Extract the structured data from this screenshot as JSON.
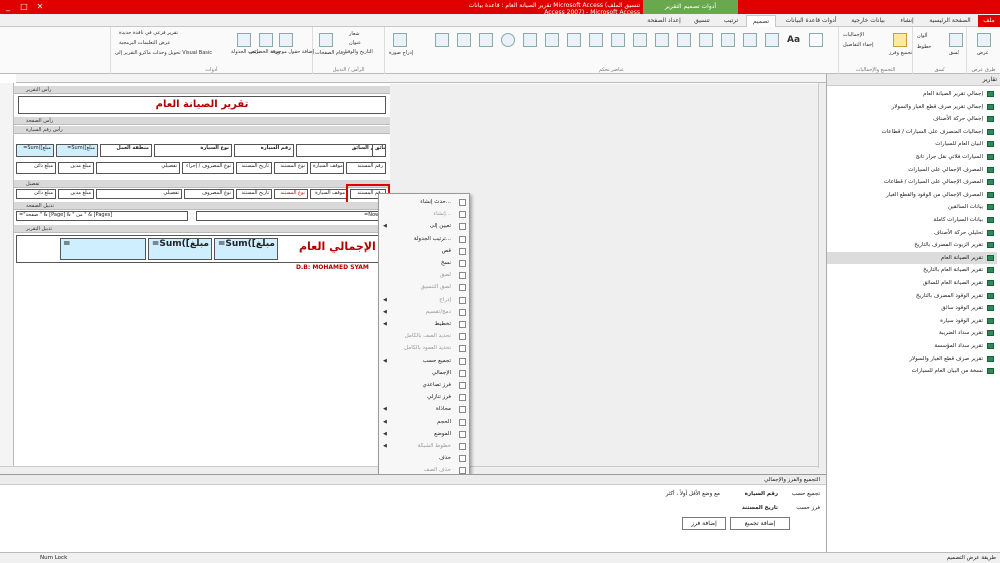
{
  "window": {
    "title": "تقرير الصيانة العام : قاعدة بيانات Microsoft Access (تنسيق الملف Access 2007) - Microsoft Access",
    "tools_tab": "أدوات تصميم التقرير",
    "buttons": [
      "_",
      "□",
      "✕"
    ]
  },
  "tabs": {
    "file": "ملف",
    "home": "الصفحة الرئيسية",
    "create": "إنشاء",
    "external": "بيانات خارجية",
    "dbtools": "أدوات قاعدة البيانات",
    "design": "تصميم",
    "arrange": "ترتيب",
    "format": "تنسيق",
    "pagesetup": "إعداد الصفحة"
  },
  "ribbon": {
    "views": {
      "label": "طرق عرض",
      "view_btn": "عرض"
    },
    "themes": {
      "label": "نُسق",
      "themes_btn": "نُسق",
      "colors": "ألوان",
      "fonts": "خطوط"
    },
    "grouping": {
      "label": "التجميع والإجماليات",
      "group_sort": "تجميع وفرز",
      "totals": "الإجماليات",
      "hide_details": "إخفاء التفاصيل"
    },
    "controls": {
      "label": "عناصر تحكم",
      "insert_image": "إدراج صورة"
    },
    "header_footer": {
      "label": "الرأس / التذييل",
      "logo": "شعار",
      "title": "عنوان",
      "date_time": "التاريخ والوقت",
      "page_numbers": "أرقام الصفحات"
    },
    "tools": {
      "label": "أدوات",
      "add_fields": "إضافة حقول موجودة",
      "property_sheet": "ورقة الخصائص",
      "tab_order": "ترتيب الجدولة",
      "subreport": "تقرير فرعي في نافذة جديدة",
      "view_code": "عرض التعليمات البرمجية",
      "convert_macros": "تحويل وحدات ماكرو التقرير إلى Visual Basic"
    }
  },
  "nav": {
    "header": "تقارير",
    "items": [
      "إجمالي تقرير الصيانة العام",
      "إجمالي تقرير صرف قطع الغيار والسولار",
      "إجمالي حركة الأصناف",
      "إجماليات المنصرف على السيارات / قطاعات",
      "البيان العام للسيارات",
      "السيارات فلاتي نقل جرار تانج",
      "المصرف الإجمالي على السيارات",
      "المصرف الإجمالي على السيارات / قطاعات",
      "المصرف الإجمالي من الوقود والقطع الغيار",
      "بيانات السائقين",
      "بيانات السيارات كاملة",
      "تحليلي حركة الأصناف",
      "تقرير الزيوت المصرف بالتاريخ",
      "تقرير الصيانة العام",
      "تقرير الصيانة العام بالتاريخ",
      "تقرير الصيانة العام للسائق",
      "تقرير الوقود المصرف بالتاريخ",
      "تقرير الوقود سائق",
      "تقرير الوقود سيارة",
      "تقرير سداد الضريبة",
      "تقرير سداد المؤسسة",
      "تقرير صرف قطع الغيار والسولار",
      "نسخة من  البيان العام للسيارات"
    ],
    "selected_index": 13
  },
  "report": {
    "sections": {
      "report_header": "رأس التقرير",
      "page_header": "رأس الصفحة",
      "car_header": "رأس رقم السيارة",
      "detail": "تفصيل",
      "page_footer": "تذييل الصفحة",
      "report_footer": "تذييل التقرير"
    },
    "title": "تقرير الصيانة العام",
    "group_row": {
      "driver_name_label": "اسم السائق",
      "car_number_label": "رقم السيارة",
      "car_type_label": "نوع السيارة",
      "work_area_label": "منطقة العمل",
      "driver": "السائق",
      "sum1": "=Sum([مبلغ",
      "sum2": "=Sum([مبلغ"
    },
    "columns": {
      "receipt_no": "رقم المستند",
      "car_status": "موقف السيارة",
      "doc_type": "نوع المستند",
      "doc_date": "تاريخ المستند",
      "spend_type": "نوع المصروف / إجراء",
      "details": "تفصيلي",
      "amount_due": "مبلغ مدين",
      "amount_paid": "مبلغ دائن"
    },
    "detail_fields": {
      "receipt_no": "رقم المستند",
      "car_status": "موقف السيارة",
      "doc_type": "نوع المستند",
      "doc_date": "تاريخ المستند",
      "spend_type": "نوع المصروف",
      "details": "تفصيلي",
      "amount_due": "مبلغ مدين",
      "amount_paid": "مبلغ دائن"
    },
    "page_footer": {
      "page_expr": "=\"صفحة \" & [Page] & \" من \" & [Pages]",
      "now_expr": "=Now()"
    },
    "report_footer": {
      "total_label": "الإجمالي العام :",
      "sum1": "=Sum([مبلغ",
      "sum2": "=Sum([مبلغ",
      "expr3": "=",
      "author": "D.B: MOHAMED SYAM"
    }
  },
  "context_menu": {
    "items": [
      {
        "label": "حدث إنشاء...",
        "disabled": false
      },
      {
        "label": "إنشاء...",
        "disabled": true
      },
      {
        "label": "تعيين إلى",
        "disabled": false
      },
      {
        "label": "ترتيب الجدولة...",
        "disabled": false
      },
      {
        "label": "قص",
        "disabled": false
      },
      {
        "label": "نسخ",
        "disabled": false
      },
      {
        "label": "لصق",
        "disabled": true
      },
      {
        "label": "لصق التنسيق",
        "disabled": true
      },
      {
        "label": "إدراج",
        "disabled": true
      },
      {
        "label": "دمج/تقسيم",
        "disabled": true
      },
      {
        "label": "تخطيط",
        "disabled": false
      },
      {
        "label": "تحديد الصف بالكامل",
        "disabled": true
      },
      {
        "label": "تحديد العمود بالكامل",
        "disabled": true
      },
      {
        "label": "تجميع حسب",
        "disabled": false
      },
      {
        "label": "الإجمالي",
        "disabled": false
      },
      {
        "label": "فرز تصاعدي",
        "disabled": false
      },
      {
        "label": "فرز تنازلي",
        "disabled": false
      },
      {
        "label": "محاذاة",
        "disabled": false
      },
      {
        "label": "الحجم",
        "disabled": false
      },
      {
        "label": "الموضع",
        "disabled": false
      },
      {
        "label": "خطوط الشبكة",
        "disabled": true
      },
      {
        "label": "حذف",
        "disabled": false
      },
      {
        "label": "حذف الصف",
        "disabled": true
      },
      {
        "label": "حذف عمود",
        "disabled": true
      },
      {
        "label": "لون التعبئة/الخلفية",
        "disabled": false
      },
      {
        "label": "لون الخط/الحدود",
        "disabled": false
      },
      {
        "label": "تغيير إلى",
        "disabled": false
      },
      {
        "label": "تنسيق شرطي...",
        "disabled": false
      },
      {
        "label": "خصائص التقرير",
        "disabled": false
      },
      {
        "label": "خصائص",
        "disabled": false
      }
    ]
  },
  "group_pane": {
    "header": "التجميع والفرز والإجمالي",
    "group_by": "تجميع حسب",
    "group_field": "رقم السيارة",
    "group_opts": "مع وضع الأقل أولاً ، أكثر",
    "sort_by": "فرز حسب",
    "sort_field": "تاريخ المستند",
    "add_group": "إضافة تجميع",
    "add_sort": "إضافة فرز"
  },
  "status": {
    "left": "طريقة عرض التصميم",
    "numlock": "Num Lock"
  },
  "colors": {
    "title_red": "#e00000",
    "tools_green": "#6aa84f",
    "cyan_box": "#cfefff"
  }
}
